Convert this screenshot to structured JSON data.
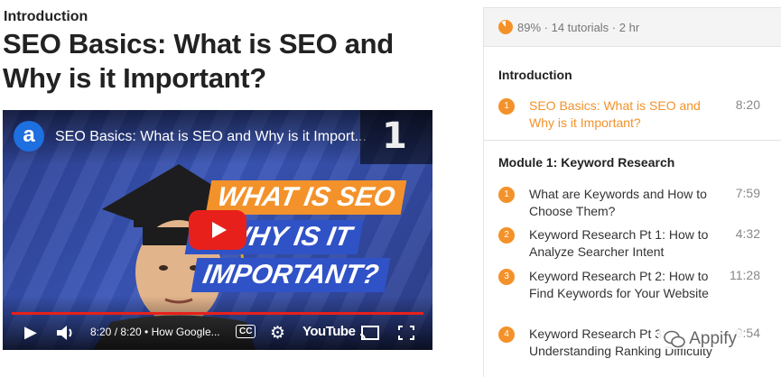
{
  "section_label": "Introduction",
  "page_title": "SEO Basics: What is SEO and Why is it Important?",
  "player": {
    "channel_logo": "a",
    "video_title": "SEO Basics: What is SEO and Why is it Import...",
    "thumb_line1": "WHAT IS SEO",
    "thumb_line2": "D WHY IS IT",
    "thumb_line3": "IMPORTANT?",
    "time": "8:20 / 8:20 • How Google...",
    "progress": 1.0,
    "cc_label": "CC",
    "youtube_label": "YouTube",
    "badge": "1"
  },
  "sidebar": {
    "progress_percent": 89,
    "stats_percent": "89%",
    "stats_tutorials": "14 tutorials",
    "stats_duration": "2 hr",
    "intro_heading": "Introduction",
    "intro_lesson": {
      "number": "1",
      "title": "SEO Basics: What is SEO and Why is it Important?",
      "duration": "8:20"
    },
    "module1_heading": "Module 1: Keyword Research",
    "lessons": [
      {
        "number": "1",
        "title": "What are Keywords and How to Choose Them?",
        "duration": "7:59"
      },
      {
        "number": "2",
        "title": "Keyword Research Pt 1: How to Analyze Searcher Intent",
        "duration": "4:32"
      },
      {
        "number": "3",
        "title": "Keyword Research Pt 2: How to Find Keywords for Your Website",
        "duration": "11:28"
      },
      {
        "number": "4",
        "title": "Keyword Research Pt 3: Understanding Ranking Difficulty",
        "duration": "9:54"
      }
    ]
  },
  "watermark": "Appify",
  "colors": {
    "accent": "#f3922a",
    "player_red": "#e8201c",
    "text": "#222222"
  }
}
